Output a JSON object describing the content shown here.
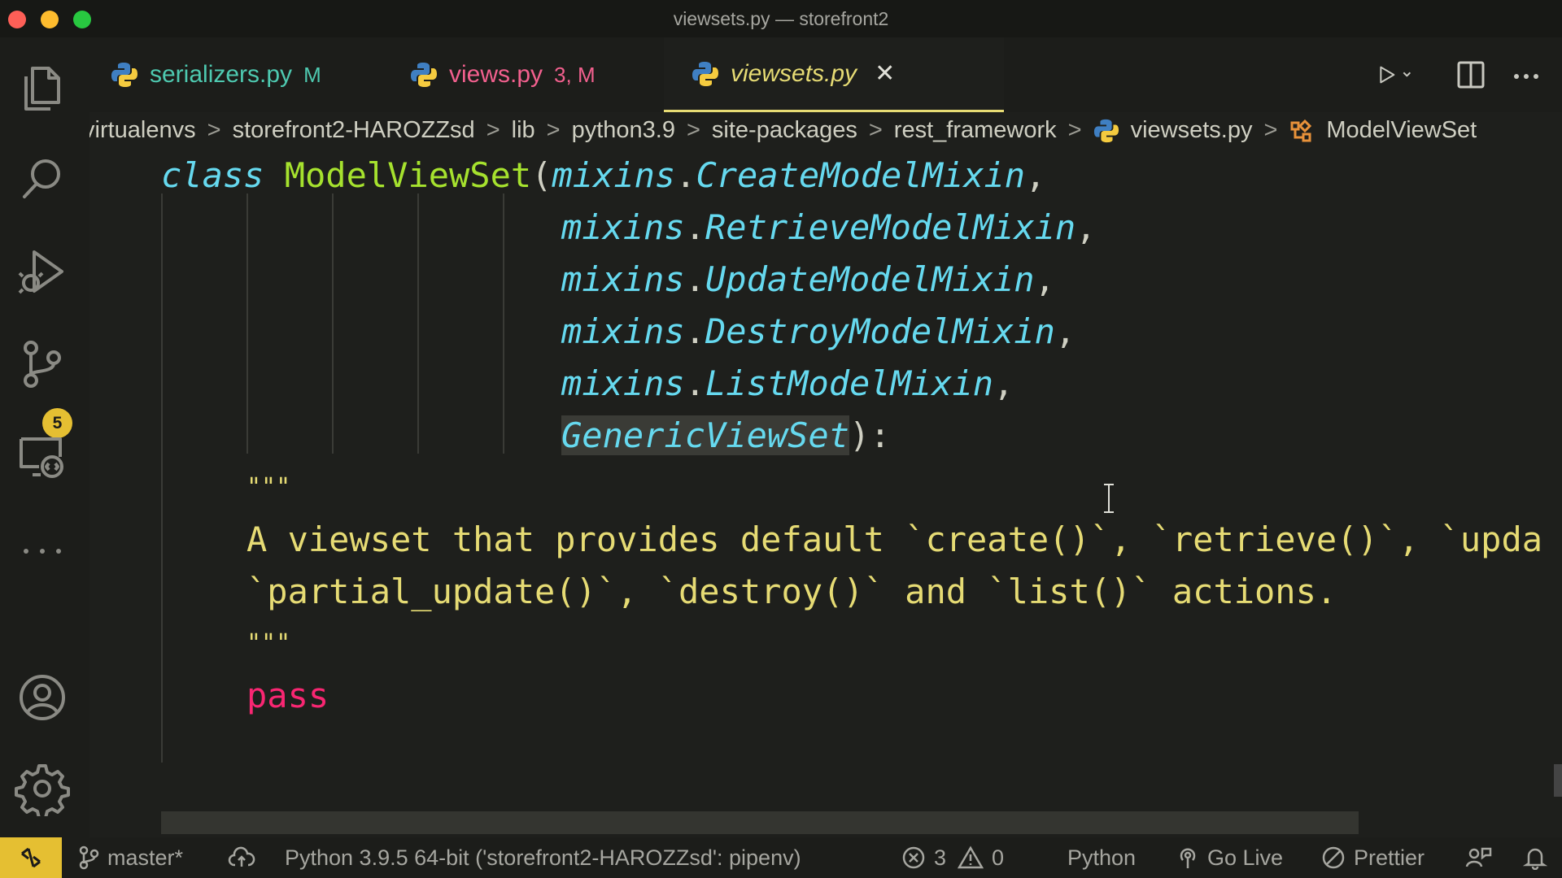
{
  "window": {
    "title": "viewsets.py — storefront2"
  },
  "activity_bar": {
    "source_control_badge": "5"
  },
  "tabs": [
    {
      "label": "serializers.py",
      "status": "M",
      "label_color": "#4ec9b0",
      "status_color": "#4ec9b0"
    },
    {
      "label": "views.py",
      "status": "3, M",
      "label_color": "#f2608e",
      "status_color": "#f2608e"
    },
    {
      "label": "viewsets.py",
      "status": "",
      "label_color": "#e6db74",
      "active": true
    }
  ],
  "breadcrumb": {
    "items": [
      "virtualenvs",
      "storefront2-HAROZZsd",
      "lib",
      "python3.9",
      "site-packages",
      "rest_framework",
      "viewsets.py",
      "ModelViewSet"
    ],
    "separator": ">"
  },
  "code": {
    "class_keyword": "class",
    "class_name": "ModelViewSet",
    "open_paren": "(",
    "bases": [
      {
        "module": "mixins",
        "dot": ".",
        "name": "CreateModelMixin",
        "trail": ","
      },
      {
        "module": "mixins",
        "dot": ".",
        "name": "RetrieveModelMixin",
        "trail": ","
      },
      {
        "module": "mixins",
        "dot": ".",
        "name": "UpdateModelMixin",
        "trail": ","
      },
      {
        "module": "mixins",
        "dot": ".",
        "name": "DestroyModelMixin",
        "trail": ","
      },
      {
        "module": "mixins",
        "dot": ".",
        "name": "ListModelMixin",
        "trail": ","
      }
    ],
    "last_base": "GenericViewSet",
    "close": "):",
    "docstring_open": "\"\"\"",
    "docstring_line1": "A viewset that provides default `create()`, `retrieve()`, `upda",
    "docstring_line2": "`partial_update()`, `destroy()` and `list()` actions.",
    "docstring_close": "\"\"\"",
    "body": "pass"
  },
  "statusbar": {
    "branch": "master*",
    "interpreter": "Python 3.9.5 64-bit ('storefront2-HAROZZsd': pipenv)",
    "errors": "3",
    "warnings": "0",
    "language": "Python",
    "go_live": "Go Live",
    "prettier": "Prettier"
  },
  "colors": {
    "accent": "#e5bf32",
    "keyword": "#66d9ef",
    "class_name": "#a6e22e",
    "string": "#e6db74",
    "pass": "#f92672"
  }
}
